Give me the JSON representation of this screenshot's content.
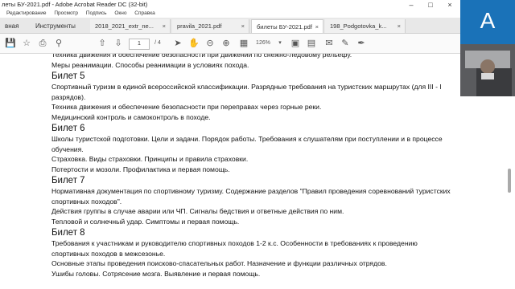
{
  "window": {
    "title": "леты БУ-2021.pdf - Adobe Acrobat Reader DC (32-bit)",
    "menu": [
      "Редактирование",
      "Просмотр",
      "Подпись",
      "Окно",
      "Справка"
    ]
  },
  "tabs": [
    {
      "label": "вная"
    },
    {
      "label": "Инструменты"
    },
    {
      "label": "2018_2021_extr_ne..."
    },
    {
      "label": "pravila_2021.pdf"
    },
    {
      "label": "билеты БУ-2021.pdf"
    },
    {
      "label": "198_Podgotovka_k..."
    }
  ],
  "toolbar": {
    "current_page": "1",
    "total_pages": "/ 4",
    "zoom": "126%"
  },
  "document": {
    "blocks": [
      {
        "type": "para",
        "text": "Техника движения и обеспечение безопасности при движении по снежно-ледовому рельефу."
      },
      {
        "type": "para",
        "text": "Меры реанимации. Способы реанимации в условиях похода."
      },
      {
        "type": "heading",
        "text": "Билет 5"
      },
      {
        "type": "para",
        "text": "Спортивный туризм в единой всероссийской классификации. Разрядные требования на туристских маршрутах (для III - I разрядов)."
      },
      {
        "type": "para",
        "text": "Техника движения и обеспечение безопасности при переправах через горные реки."
      },
      {
        "type": "para",
        "text": "Медицинский контроль и самоконтроль в походе."
      },
      {
        "type": "heading",
        "text": "Билет 6"
      },
      {
        "type": "para",
        "text": "Школы туристской подготовки. Цели и задачи. Порядок работы. Требования к слушателям при поступлении и в процессе обучения."
      },
      {
        "type": "para",
        "text": "Страховка. Виды страховки. Принципы и правила страховки."
      },
      {
        "type": "para",
        "text": "Потертости и мозоли. Профилактика и первая помощь."
      },
      {
        "type": "heading",
        "text": "Билет 7"
      },
      {
        "type": "para",
        "text": "Нормативная документация по спортивному туризму. Содержание разделов \"Правил проведения соревнований туристских спортивных походов\"."
      },
      {
        "type": "para",
        "text": "Действия группы в случае аварии или ЧП. Сигналы бедствия и ответные действия по ним."
      },
      {
        "type": "para",
        "text": "Тепловой и солнечный удар. Симптомы и первая помощь."
      },
      {
        "type": "heading",
        "text": "Билет 8"
      },
      {
        "type": "para",
        "text": "Требования к участникам и руководителю спортивных походов 1-2 к.с. Особенности в требованиях к проведению спортивных походов в межсезонье."
      },
      {
        "type": "para",
        "text": "Основные этапы проведения поисково-спасательных работ. Назначение и функции различных отрядов."
      },
      {
        "type": "para",
        "text": "Ушибы головы. Сотрясение мозга. Выявление и первая помощь."
      }
    ]
  },
  "participant": {
    "avatar_letter": "A",
    "avatar_color": "#1a72b8"
  }
}
